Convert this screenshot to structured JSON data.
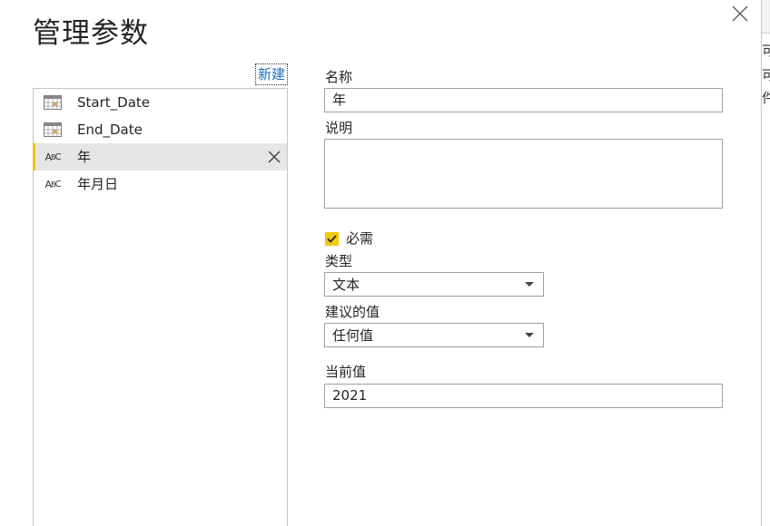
{
  "dialog": {
    "title": "管理参数",
    "new_link": "新建",
    "close_icon": "close-icon"
  },
  "parameters": [
    {
      "label": "Start_Date",
      "icon": "calendar-icon",
      "selected": false
    },
    {
      "label": "End_Date",
      "icon": "calendar-icon",
      "selected": false
    },
    {
      "label": "年",
      "icon": "text-type-icon",
      "selected": true
    },
    {
      "label": "年月日",
      "icon": "text-type-icon",
      "selected": false
    }
  ],
  "abc_icon": {
    "a": "A",
    "b": "B",
    "c": "C"
  },
  "form": {
    "name_label": "名称",
    "name_value": "年",
    "description_label": "说明",
    "description_value": "",
    "required_label": "必需",
    "required_checked": true,
    "type_label": "类型",
    "type_value": "文本",
    "suggested_label": "建议的值",
    "suggested_value": "任何值",
    "current_label": "当前值",
    "current_value": "2021"
  },
  "background_chars": [
    "可",
    "可",
    "件"
  ],
  "colors": {
    "accent": "#f2c811",
    "link": "#1a6fc2",
    "selected_row": "#e6e6e6"
  }
}
